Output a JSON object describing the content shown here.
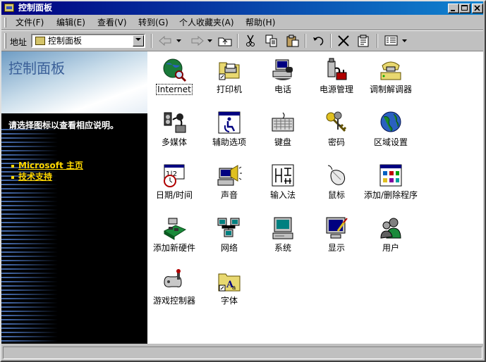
{
  "window": {
    "title": "控制面板"
  },
  "menu": [
    "文件(F)",
    "编辑(E)",
    "查看(V)",
    "转到(G)",
    "个人收藏夹(A)",
    "帮助(H)"
  ],
  "toolbar": {
    "address_label": "地址",
    "address_value": "控制面板"
  },
  "left_pane": {
    "title": "控制面板",
    "description": "请选择图标以查看相应说明。",
    "links": [
      "Microsoft 主页",
      "技术支持"
    ]
  },
  "items": [
    {
      "label": "Internet",
      "icon": "internet-icon"
    },
    {
      "label": "打印机",
      "icon": "printer-icon"
    },
    {
      "label": "电话",
      "icon": "telephony-icon"
    },
    {
      "label": "电源管理",
      "icon": "power-icon"
    },
    {
      "label": "调制解调器",
      "icon": "modem-icon"
    },
    {
      "label": "多媒体",
      "icon": "multimedia-icon"
    },
    {
      "label": "辅助选项",
      "icon": "accessibility-icon"
    },
    {
      "label": "键盘",
      "icon": "keyboard-icon"
    },
    {
      "label": "密码",
      "icon": "password-keys-icon"
    },
    {
      "label": "区域设置",
      "icon": "regional-globe-icon"
    },
    {
      "label": "日期/时间",
      "icon": "date-time-icon"
    },
    {
      "label": "声音",
      "icon": "sound-icon"
    },
    {
      "label": "输入法",
      "icon": "input-method-icon"
    },
    {
      "label": "鼠标",
      "icon": "mouse-icon"
    },
    {
      "label": "添加/删除程序",
      "icon": "add-remove-programs-icon"
    },
    {
      "label": "添加新硬件",
      "icon": "add-hardware-icon"
    },
    {
      "label": "网络",
      "icon": "network-icon"
    },
    {
      "label": "系统",
      "icon": "system-icon"
    },
    {
      "label": "显示",
      "icon": "display-icon"
    },
    {
      "label": "用户",
      "icon": "users-icon"
    },
    {
      "label": "游戏控制器",
      "icon": "game-controller-icon"
    },
    {
      "label": "字体",
      "icon": "fonts-icon"
    }
  ],
  "status": {
    "text": ""
  }
}
